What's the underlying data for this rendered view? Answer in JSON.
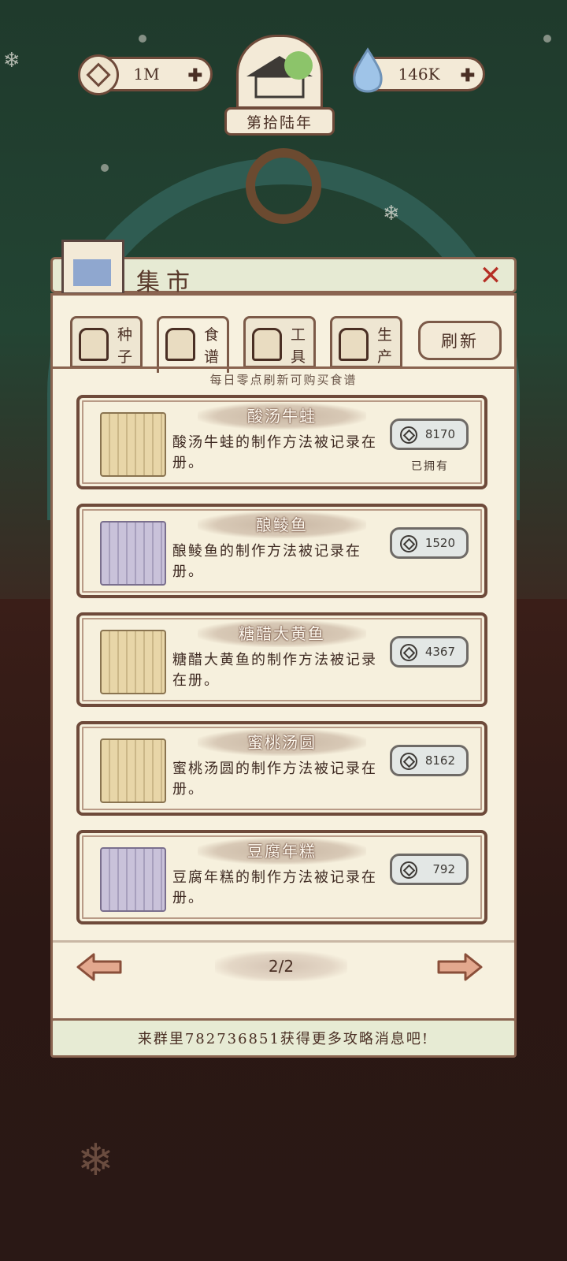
{
  "header": {
    "coins": "1M",
    "water": "146K",
    "year": "第拾陆年"
  },
  "market": {
    "title": "集市",
    "tabs": [
      {
        "line1": "种",
        "line2": "子",
        "icon": "seed-bag-icon"
      },
      {
        "line1": "食",
        "line2": "谱",
        "icon": "recipe-book-icon"
      },
      {
        "line1": "工",
        "line2": "具",
        "icon": "tool-icon"
      },
      {
        "line1": "生",
        "line2": "产",
        "icon": "production-icon"
      }
    ],
    "refresh_label": "刷新",
    "hint": "每日零点刷新可购买食谱",
    "recipes": [
      {
        "name": "酸汤牛蛙",
        "desc": "酸汤牛蛙的制作方法被记录在册。",
        "price": "8170",
        "owned": "已拥有",
        "scroll": "yellow"
      },
      {
        "name": "酿鲮鱼",
        "desc": "酿鲮鱼的制作方法被记录在册。",
        "price": "1520",
        "owned": "",
        "scroll": "purple"
      },
      {
        "name": "糖醋大黄鱼",
        "desc": "糖醋大黄鱼的制作方法被记录在册。",
        "price": "4367",
        "owned": "",
        "scroll": "yellow"
      },
      {
        "name": "蜜桃汤圆",
        "desc": "蜜桃汤圆的制作方法被记录在册。",
        "price": "8162",
        "owned": "",
        "scroll": "yellow"
      },
      {
        "name": "豆腐年糕",
        "desc": "豆腐年糕的制作方法被记录在册。",
        "price": "792",
        "owned": "",
        "scroll": "purple"
      }
    ],
    "page": "2/2"
  },
  "footer": {
    "text": "来群里782736851获得更多攻略消息吧!"
  },
  "colors": {
    "accent_close": "#b52f25",
    "panel_bg": "#f7f1df",
    "border": "#6e4a3a"
  }
}
